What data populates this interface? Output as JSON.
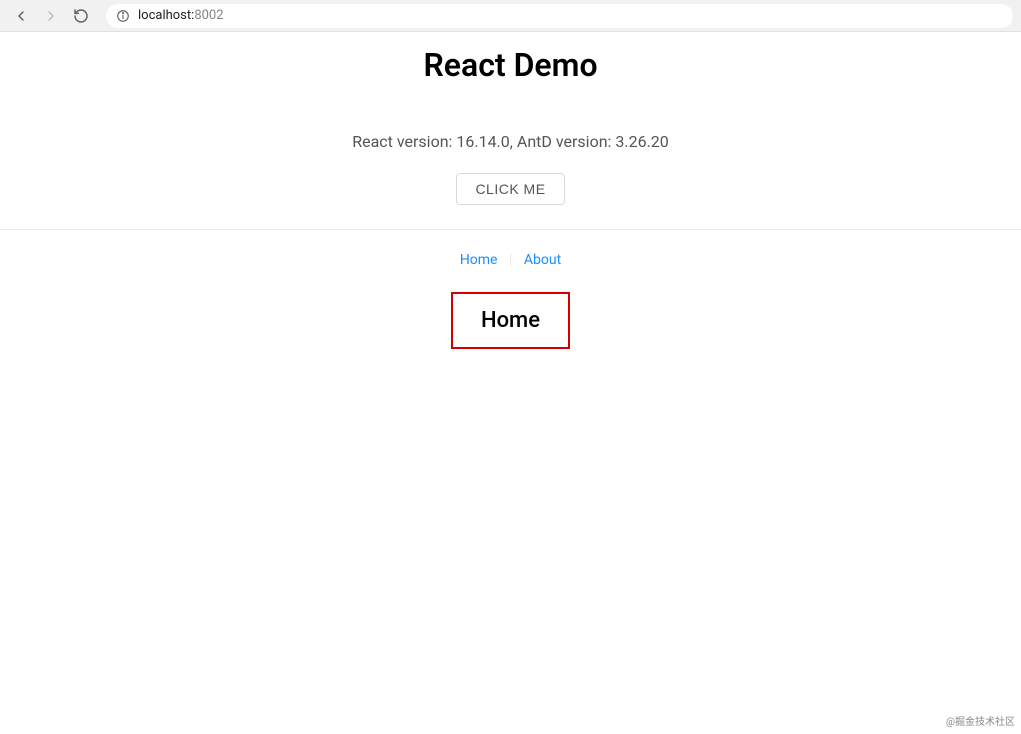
{
  "browser": {
    "url_host": "localhost:",
    "url_port": "8002"
  },
  "page": {
    "title": "React Demo",
    "version_text": "React version: 16.14.0, AntD version: 3.26.20",
    "button_label": "CLICK ME"
  },
  "nav": {
    "home": "Home",
    "about": "About",
    "separator": "|"
  },
  "route": {
    "heading": "Home"
  },
  "watermark": "@掘金技术社区"
}
